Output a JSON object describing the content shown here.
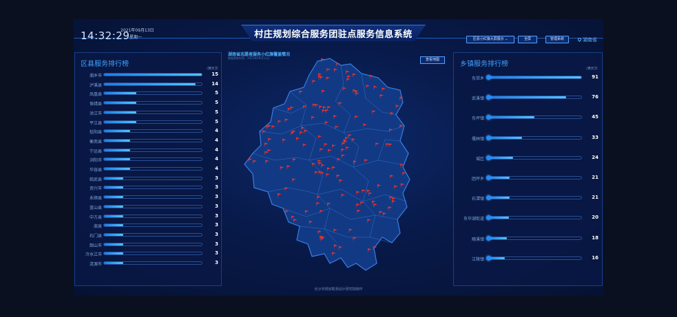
{
  "header": {
    "clock": "14:32:29",
    "date": "2021年09月13日",
    "weekday": "星期一",
    "title": "村庄规划综合服务团驻点服务信息系统",
    "view_select": "区县小红旗大屏展示",
    "fullscreen_button": "全屏",
    "admin_button": "管理系统",
    "region": "湖南省",
    "region_icon": "map-pin-icon"
  },
  "left_panel": {
    "title": "区县服务排行榜",
    "unit": "/满天次",
    "max": 15,
    "rows": [
      {
        "name": "湘乡市",
        "value": 15
      },
      {
        "name": "泸溪县",
        "value": 14
      },
      {
        "name": "凤凰县",
        "value": 5
      },
      {
        "name": "保靖县",
        "value": 5
      },
      {
        "name": "洪江市",
        "value": 5
      },
      {
        "name": "平江县",
        "value": 5
      },
      {
        "name": "桂阳县",
        "value": 4
      },
      {
        "name": "衡南县",
        "value": 4
      },
      {
        "name": "宁远县",
        "value": 4
      },
      {
        "name": "浏阳市",
        "value": 4
      },
      {
        "name": "华容县",
        "value": 4
      },
      {
        "name": "临武县",
        "value": 3
      },
      {
        "name": "资兴市",
        "value": 3
      },
      {
        "name": "永顺县",
        "value": 3
      },
      {
        "name": "蓝山县",
        "value": 3
      },
      {
        "name": "中方县",
        "value": 3
      },
      {
        "name": "溆县",
        "value": 3
      },
      {
        "name": "石门县",
        "value": 3
      },
      {
        "name": "韶山市",
        "value": 3
      },
      {
        "name": "冷水江市",
        "value": 3
      },
      {
        "name": "涟源市",
        "value": 3
      }
    ]
  },
  "right_panel": {
    "title": "乡镇服务排行榜",
    "unit": "/满天次",
    "max": 91,
    "rows": [
      {
        "name": "东郊乡",
        "value": 91
      },
      {
        "name": "武溪镇",
        "value": 76
      },
      {
        "name": "东坪镇",
        "value": 45
      },
      {
        "name": "儒林镇",
        "value": 33
      },
      {
        "name": "城区",
        "value": 24
      },
      {
        "name": "团坪乡",
        "value": 21
      },
      {
        "name": "石潭镇",
        "value": 21
      },
      {
        "name": "东华湖街道",
        "value": 20
      },
      {
        "name": "随溪镇",
        "value": 18
      },
      {
        "name": "江陵镇",
        "value": 16
      }
    ]
  },
  "map": {
    "title": "湖南省志愿者服务小红旗覆盖情况",
    "subtitle": "数据更新时间：2021年09月13日",
    "back_button": "查看地图",
    "flag_color": "#e8322f",
    "region_fill": "#123a84",
    "region_stroke": "#3d7de0"
  },
  "footer": "长沙市规划勘测设计研究院制作",
  "colors": {
    "accent": "#3fa2ff",
    "bar": "#54c4ff",
    "background": "#06133a"
  }
}
